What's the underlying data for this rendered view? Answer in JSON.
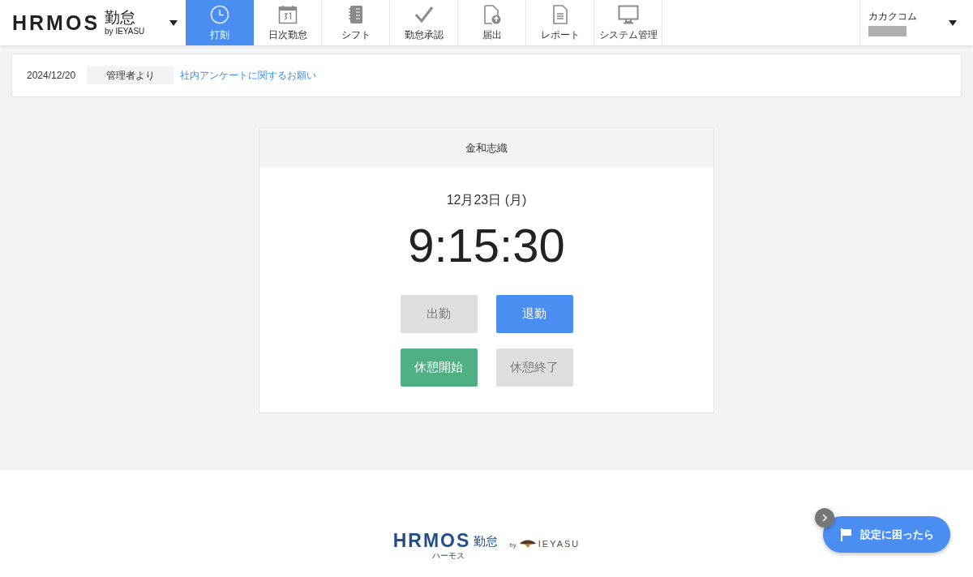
{
  "header": {
    "logo": {
      "brand": "HRMOS",
      "product": "勤怠",
      "byline": "by IEYASU"
    },
    "tabs": [
      {
        "label": "打刻",
        "selected": true
      },
      {
        "label": "日次勤怠",
        "selected": false
      },
      {
        "label": "シフト",
        "selected": false
      },
      {
        "label": "勤怠承認",
        "selected": false
      },
      {
        "label": "届出",
        "selected": false
      },
      {
        "label": "レポート",
        "selected": false
      },
      {
        "label": "システム管理",
        "selected": false
      }
    ],
    "account": {
      "company": "カカクコム"
    }
  },
  "notice": {
    "date": "2024/12/20",
    "sender": "管理者より",
    "link": "社内アンケートに関するお願い"
  },
  "clock": {
    "employee": "金和志織",
    "date": "12月23日 (月)",
    "time": "9:15:30",
    "buttons": [
      {
        "label": "出勤",
        "disabled": true
      },
      {
        "label": "退勤",
        "kind": "primary",
        "disabled": false
      },
      {
        "label": "休憩開始",
        "kind": "success",
        "disabled": false
      },
      {
        "label": "休憩終了",
        "disabled": true
      }
    ]
  },
  "footer": {
    "brand": "HRMOS",
    "product": "勤怠",
    "reading": "ハーモス",
    "by": "by",
    "partner": "IEYASU"
  },
  "help": {
    "label": "設定に困ったら"
  }
}
